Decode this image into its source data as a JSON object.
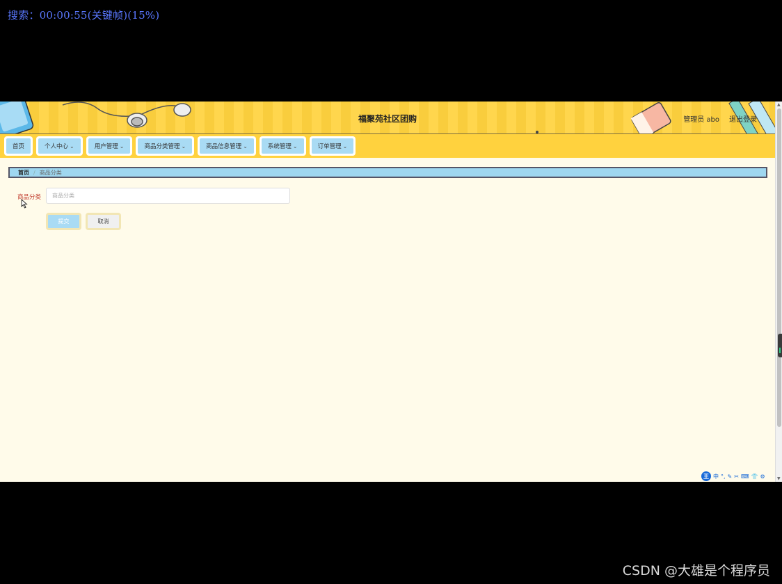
{
  "overlay": {
    "search_status": "搜索：00:00:55(关键帧)(15%)"
  },
  "header": {
    "site_title": "福聚苑社区团购",
    "user_label": "管理员 abo",
    "logout_label": "退出登录"
  },
  "nav": {
    "items": [
      {
        "label": "首页",
        "has_dropdown": false
      },
      {
        "label": "个人中心",
        "has_dropdown": true
      },
      {
        "label": "用户管理",
        "has_dropdown": true
      },
      {
        "label": "商品分类管理",
        "has_dropdown": true
      },
      {
        "label": "商品信息管理",
        "has_dropdown": true
      },
      {
        "label": "系统管理",
        "has_dropdown": true
      },
      {
        "label": "订单管理",
        "has_dropdown": true
      }
    ],
    "dropdown_icon": "chevron-down-icon"
  },
  "breadcrumb": {
    "home": "首页",
    "separator": "/",
    "current": "商品分类"
  },
  "form": {
    "field_label": "商品分类",
    "field_placeholder": "商品分类",
    "field_value": "",
    "submit_label": "提交",
    "cancel_label": "取消"
  },
  "ime_toolbar": {
    "logo": "王",
    "mode": "中",
    "icons": [
      "punctuation-icon",
      "pen-icon",
      "scissors-icon",
      "keyboard-icon",
      "skin-icon",
      "settings-icon"
    ]
  },
  "watermark": "CSDN @大雄是个程序员",
  "colors": {
    "header_bg": "#ffd23e",
    "nav_button_bg": "#a9dbf4",
    "page_bg": "#fffbea",
    "label_red": "#c0392b"
  }
}
